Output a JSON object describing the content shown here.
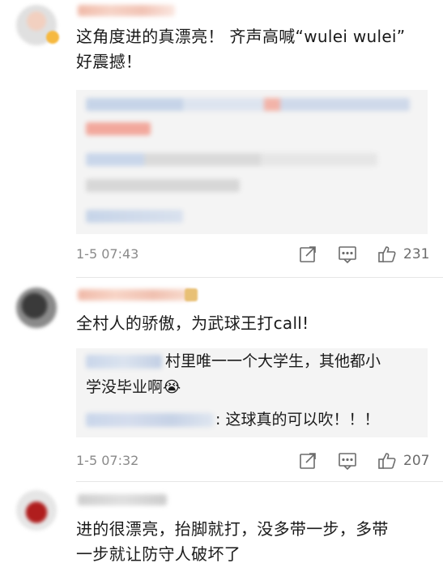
{
  "comments": [
    {
      "text_line1": "这角度进的真漂亮！ 齐声高喊“wulei wulei”",
      "text_line2": "好震撼！",
      "time": "1-5 07:43",
      "likes": "231"
    },
    {
      "text_line1": "全村人的骄傲，为武球王打call!",
      "reply1_line1": "村里唯一一个大学生，其他都小",
      "reply1_line2": "学没毕业啊",
      "reply1_emoji": "😭",
      "reply2_text": ": 这球真的可以吹！！！",
      "time": "1-5 07:32",
      "likes": "207"
    },
    {
      "text_line1": "进的很漂亮，抬脚就打，没多带一步，多带",
      "text_line2": "一步就让防守人破坏了"
    }
  ],
  "icons": {
    "share": "share-icon",
    "comment": "comment-icon",
    "like": "thumbs-up-icon"
  },
  "colors": {
    "time": "#8a8a8a",
    "reply_bg": "#f4f4f4",
    "like_count": "#6b6b6b"
  }
}
